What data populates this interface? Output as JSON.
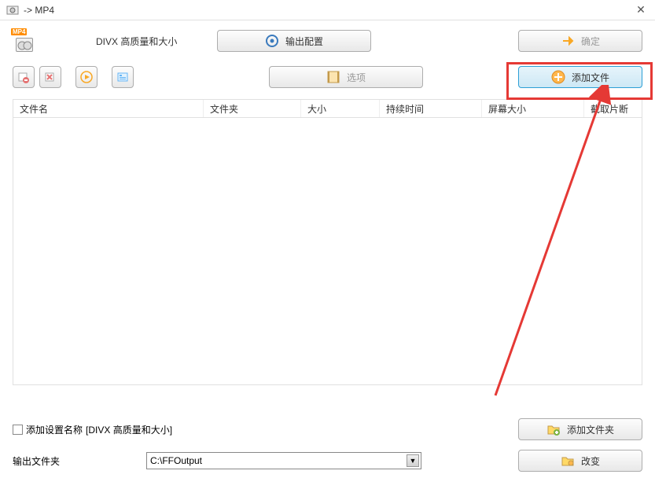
{
  "window": {
    "title": " -> MP4"
  },
  "profile": {
    "label": "DIVX 高质量和大小"
  },
  "buttons": {
    "output_config": "输出配置",
    "ok": "确定",
    "options": "选项",
    "add_file": "添加文件",
    "add_folder": "添加文件夹",
    "change": "改变"
  },
  "columns": {
    "name": "文件名",
    "folder": "文件夹",
    "size": "大小",
    "duration": "持续时间",
    "screen": "屏幕大小",
    "trim": "截取片断"
  },
  "checkbox": {
    "label_prefix": "添加设置名称",
    "label_suffix": " [DIVX 高质量和大小]"
  },
  "output": {
    "label": "输出文件夹",
    "path": "C:\\FFOutput"
  }
}
